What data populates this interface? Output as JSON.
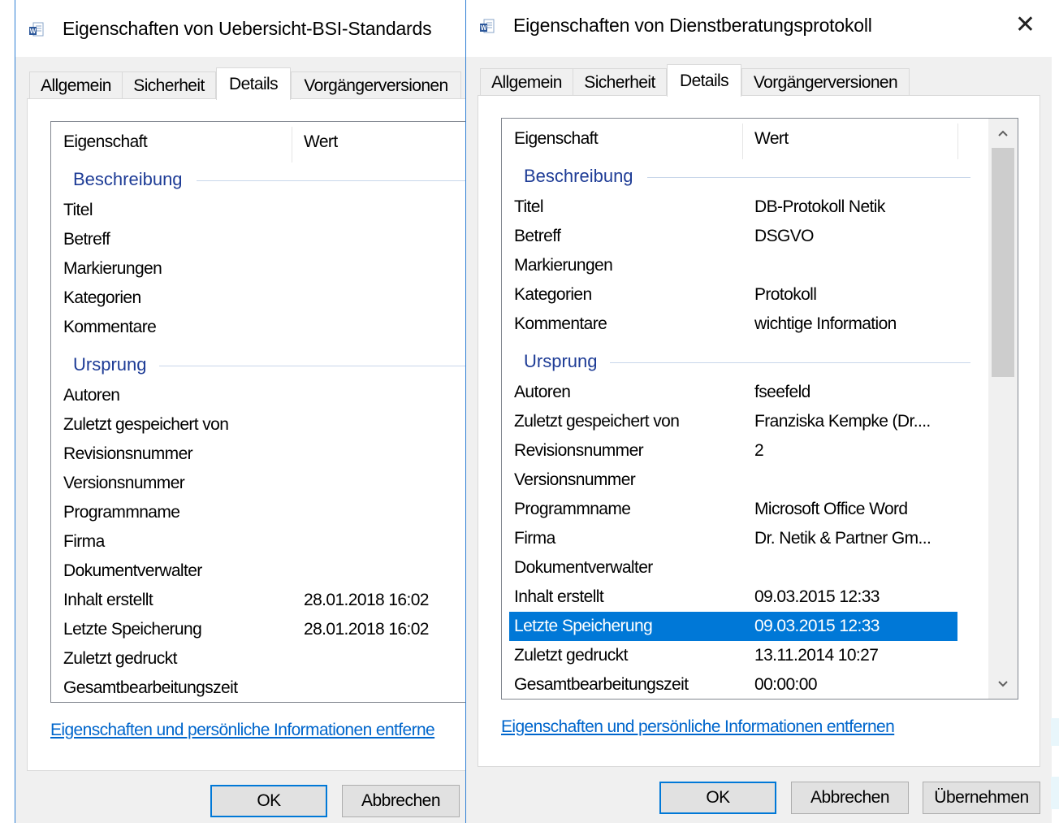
{
  "left": {
    "title": "Eigenschaften von Uebersicht-BSI-Standards",
    "tabs": [
      "Allgemein",
      "Sicherheit",
      "Details",
      "Vorgängerversionen"
    ],
    "header": {
      "property": "Eigenschaft",
      "value": "Wert"
    },
    "groups": [
      "Beschreibung",
      "Ursprung"
    ],
    "rows": [
      {
        "k": "Titel",
        "v": ""
      },
      {
        "k": "Betreff",
        "v": ""
      },
      {
        "k": "Markierungen",
        "v": ""
      },
      {
        "k": "Kategorien",
        "v": ""
      },
      {
        "k": "Kommentare",
        "v": ""
      },
      {
        "k": "Autoren",
        "v": ""
      },
      {
        "k": "Zuletzt gespeichert von",
        "v": ""
      },
      {
        "k": "Revisionsnummer",
        "v": ""
      },
      {
        "k": "Versionsnummer",
        "v": ""
      },
      {
        "k": "Programmname",
        "v": ""
      },
      {
        "k": "Firma",
        "v": ""
      },
      {
        "k": "Dokumentverwalter",
        "v": ""
      },
      {
        "k": "Inhalt erstellt",
        "v": "28.01.2018 16:02"
      },
      {
        "k": "Letzte Speicherung",
        "v": "28.01.2018 16:02"
      },
      {
        "k": "Zuletzt gedruckt",
        "v": ""
      },
      {
        "k": "Gesamtbearbeitungszeit",
        "v": ""
      }
    ],
    "link": "Eigenschaften und persönliche Informationen entferne",
    "buttons": {
      "ok": "OK",
      "cancel": "Abbrechen"
    }
  },
  "right": {
    "title": "Eigenschaften von Dienstberatungsprotokoll",
    "close": "✕",
    "tabs": [
      "Allgemein",
      "Sicherheit",
      "Details",
      "Vorgängerversionen"
    ],
    "header": {
      "property": "Eigenschaft",
      "value": "Wert"
    },
    "groups": [
      "Beschreibung",
      "Ursprung"
    ],
    "rows": [
      {
        "k": "Titel",
        "v": "DB-Protokoll Netik"
      },
      {
        "k": "Betreff",
        "v": "DSGVO"
      },
      {
        "k": "Markierungen",
        "v": ""
      },
      {
        "k": "Kategorien",
        "v": "Protokoll"
      },
      {
        "k": "Kommentare",
        "v": "wichtige Information"
      },
      {
        "k": "Autoren",
        "v": "fseefeld"
      },
      {
        "k": "Zuletzt gespeichert von",
        "v": "Franziska Kempke (Dr...."
      },
      {
        "k": "Revisionsnummer",
        "v": "2"
      },
      {
        "k": "Versionsnummer",
        "v": ""
      },
      {
        "k": "Programmname",
        "v": "Microsoft Office Word"
      },
      {
        "k": "Firma",
        "v": "Dr. Netik & Partner Gm..."
      },
      {
        "k": "Dokumentverwalter",
        "v": ""
      },
      {
        "k": "Inhalt erstellt",
        "v": "09.03.2015 12:33"
      },
      {
        "k": "Letzte Speicherung",
        "v": "09.03.2015 12:33"
      },
      {
        "k": "Zuletzt gedruckt",
        "v": "13.11.2014 10:27"
      },
      {
        "k": "Gesamtbearbeitungszeit",
        "v": "00:00:00"
      }
    ],
    "selected_row": "Letzte Speicherung",
    "link": "Eigenschaften und persönliche Informationen entfernen",
    "buttons": {
      "ok": "OK",
      "cancel": "Abbrechen",
      "apply": "Übernehmen"
    }
  },
  "colors": {
    "accent": "#0078d7",
    "group": "#1e3c96",
    "link": "#0066cc"
  }
}
